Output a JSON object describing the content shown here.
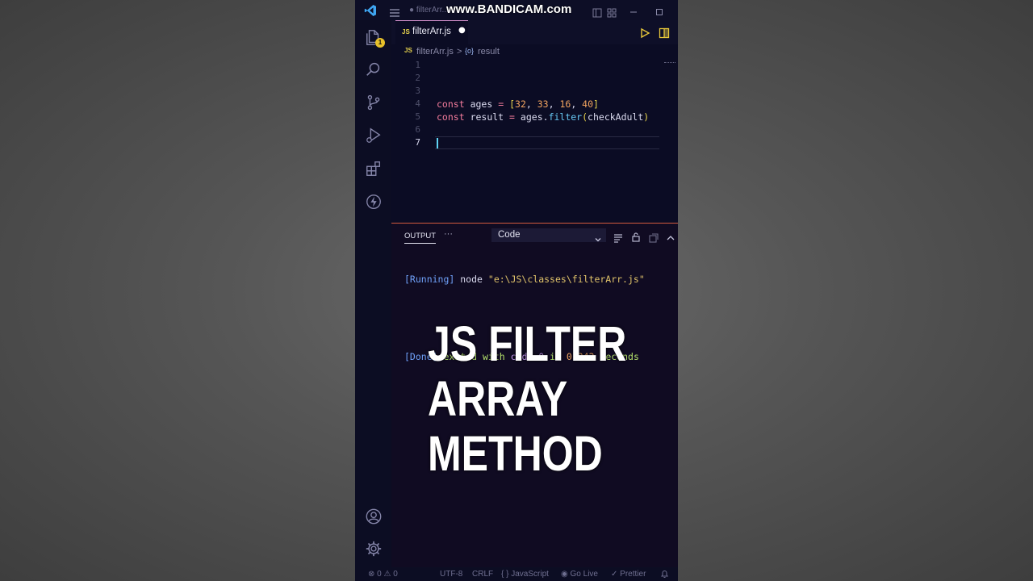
{
  "watermark": "www.BANDICAM.com",
  "window": {
    "title": "● filterArr..."
  },
  "activity_bar": {
    "explorer_badge": "1"
  },
  "tab": {
    "file_icon": "JS",
    "name": "filterArr.js",
    "dirty_marker": "●"
  },
  "breadcrumb": {
    "file_icon": "JS",
    "file": "filterArr.js",
    "separator": ">",
    "symbol_icon": "{o}",
    "symbol": "result"
  },
  "editor": {
    "line_numbers": [
      "1",
      "2",
      "3",
      "4",
      "5",
      "6",
      "7"
    ],
    "line4": {
      "kw": "const",
      "name": "ages",
      "eq": "=",
      "open": "[",
      "n1": "32",
      "n2": "33",
      "n3": "16",
      "n4": "40",
      "close": "]",
      "comma": ", "
    },
    "line5": {
      "kw": "const",
      "name": "result",
      "eq": "=",
      "obj": "ages",
      "dot": ".",
      "method": "filter",
      "open": "(",
      "arg": "checkAdult",
      "close": ")"
    }
  },
  "panel": {
    "tab_label": "OUTPUT",
    "more": "···",
    "channel": "Code",
    "lines": {
      "running_tag": "[Running]",
      "running_cmd": "node",
      "running_path": "\"e:\\JS\\classes\\filterArr.js\"",
      "done_tag": "[Done]",
      "done_text": "exited with",
      "done_code": "code=0",
      "done_in": "in",
      "done_time": "0.242",
      "done_unit": "seconds"
    }
  },
  "overlay": {
    "line1": "JS FILTER",
    "line2": "ARRAY",
    "line3": "METHOD"
  },
  "statusbar": {
    "errors": "0",
    "warnings": "0",
    "encoding": "UTF-8",
    "eol": "CRLF",
    "language_icon": "{ }",
    "language": "JavaScript",
    "golive": "Go Live",
    "prettier": "Prettier"
  },
  "colors": {
    "editor_bg": "#0b0c24",
    "panel_border": "#d35a3e",
    "keyword": "#f47c9c",
    "number": "#f2a460",
    "function": "#67c8f4"
  }
}
